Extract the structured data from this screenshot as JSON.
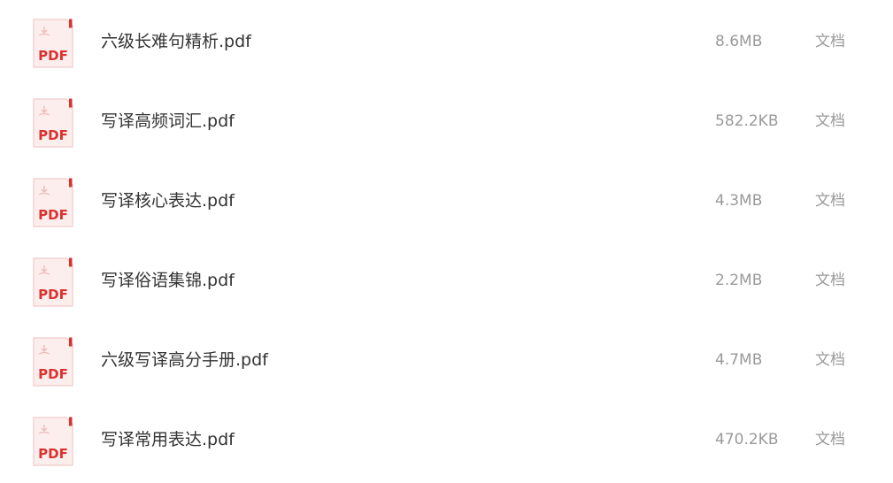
{
  "files": [
    {
      "icon": "pdf-file-icon",
      "name": "六级长难句精析.pdf",
      "size": "8.6MB",
      "type": "文档"
    },
    {
      "icon": "pdf-file-icon",
      "name": "写译高频词汇.pdf",
      "size": "582.2KB",
      "type": "文档"
    },
    {
      "icon": "pdf-file-icon",
      "name": "写译核心表达.pdf",
      "size": "4.3MB",
      "type": "文档"
    },
    {
      "icon": "pdf-file-icon",
      "name": "写译俗语集锦.pdf",
      "size": "2.2MB",
      "type": "文档"
    },
    {
      "icon": "pdf-file-icon",
      "name": "六级写译高分手册.pdf",
      "size": "4.7MB",
      "type": "文档"
    },
    {
      "icon": "pdf-file-icon",
      "name": "写译常用表达.pdf",
      "size": "470.2KB",
      "type": "文档"
    }
  ],
  "icon_label": "PDF",
  "colors": {
    "pdf_red": "#d9322f",
    "pdf_bg": "#fdeeee",
    "name_text": "#333333",
    "meta_text": "#9a9a9a"
  }
}
